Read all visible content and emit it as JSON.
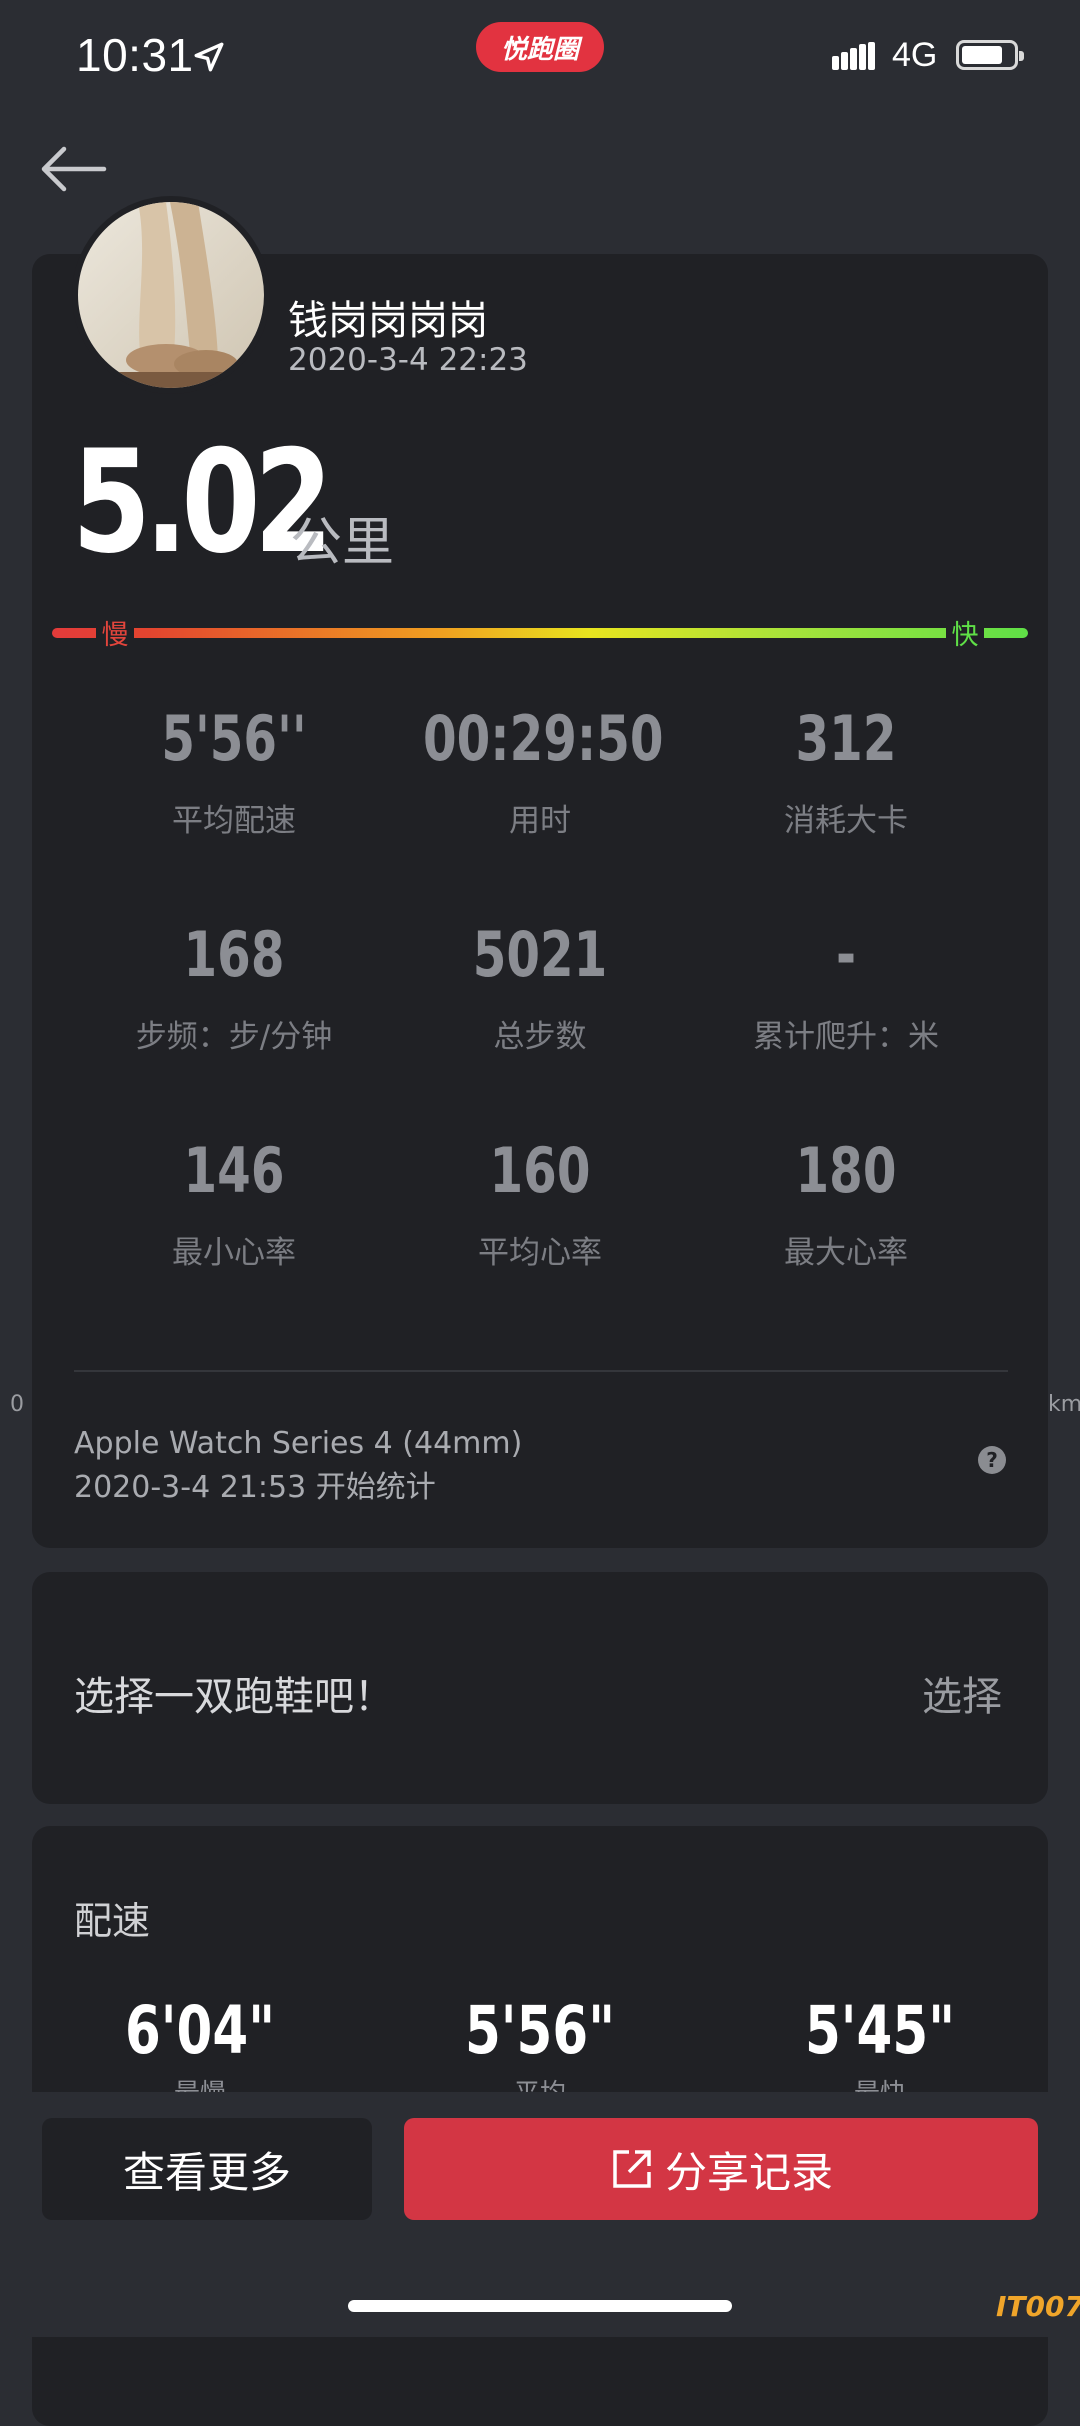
{
  "status_bar": {
    "time": "10:31",
    "app_badge": "悦跑圈",
    "network": "4G"
  },
  "profile": {
    "name": "钱岗岗岗岗",
    "datetime": "2020-3-4 22:23"
  },
  "run": {
    "distance": "5.02",
    "distance_unit": "公里",
    "slow_label": "慢",
    "fast_label": "快"
  },
  "stats": [
    {
      "value": "5'56''",
      "label": "平均配速"
    },
    {
      "value": "00:29:50",
      "label": "用时"
    },
    {
      "value": "312",
      "label": "消耗大卡"
    },
    {
      "value": "168",
      "label": "步频：步/分钟"
    },
    {
      "value": "5021",
      "label": "总步数"
    },
    {
      "value": "-",
      "label": "累计爬升：米"
    },
    {
      "value": "146",
      "label": "最小心率"
    },
    {
      "value": "160",
      "label": "平均心率"
    },
    {
      "value": "180",
      "label": "最大心率"
    }
  ],
  "device": {
    "name": "Apple Watch Series 4 (44mm)",
    "start": "2020-3-4 21:53 开始统计",
    "help": "?"
  },
  "edge_labels": {
    "left": "0",
    "right": "km"
  },
  "shoe": {
    "prompt": "选择一双跑鞋吧！",
    "action": "选择"
  },
  "pace": {
    "title": "配速",
    "columns": [
      {
        "value": "6'04\"",
        "label": "最慢"
      },
      {
        "value": "5'56\"",
        "label": "平均"
      },
      {
        "value": "5'45\"",
        "label": "最快"
      }
    ]
  },
  "actions": {
    "more": "查看更多",
    "share": "分享记录"
  },
  "watermark": "IT007",
  "colors": {
    "accent": "#d33644",
    "slow": "#e3453c",
    "fast": "#5fe047"
  }
}
